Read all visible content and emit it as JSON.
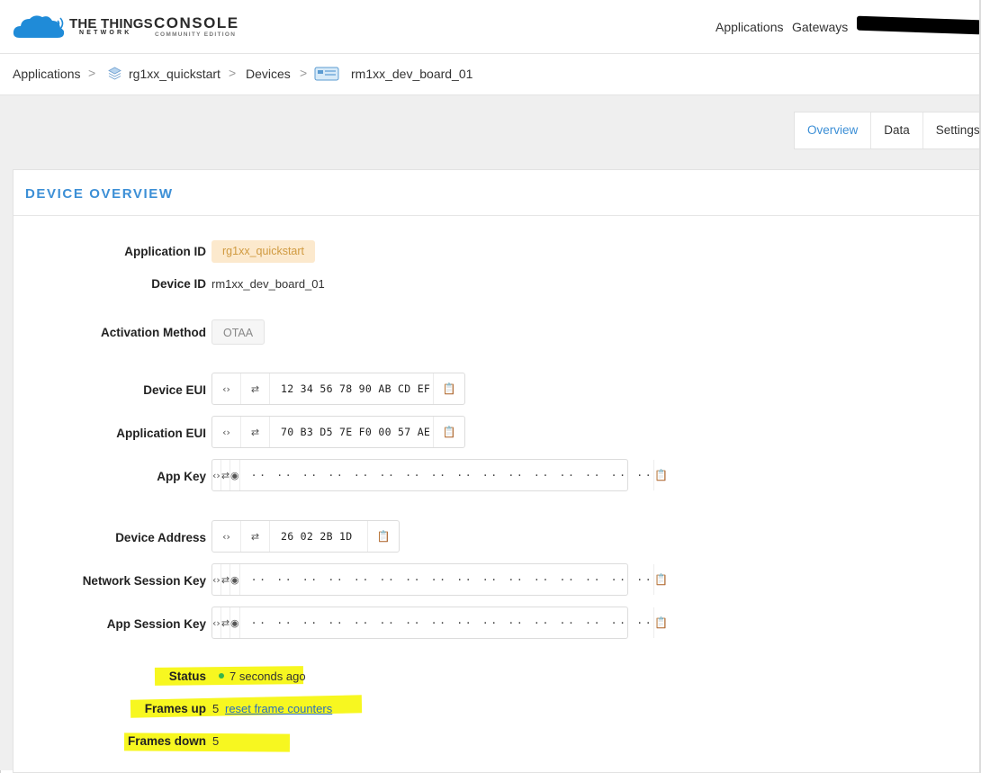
{
  "header": {
    "brand_line1": "THE THINGS",
    "brand_line2": "NETWORK",
    "console_line1": "CONSOLE",
    "console_line2": "COMMUNITY EDITION",
    "nav": [
      "Applications",
      "Gateways"
    ]
  },
  "breadcrumb": {
    "items": [
      "Applications",
      "rg1xx_quickstart",
      "Devices",
      "rm1xx_dev_board_01"
    ],
    "separator": ">"
  },
  "tabs": [
    "Overview",
    "Data",
    "Settings"
  ],
  "active_tab": "Overview",
  "card": {
    "title": "DEVICE OVERVIEW"
  },
  "fields": {
    "application_id": {
      "label": "Application ID",
      "value": "rg1xx_quickstart"
    },
    "device_id": {
      "label": "Device ID",
      "value": "rm1xx_dev_board_01"
    },
    "activation_method": {
      "label": "Activation Method",
      "value": "OTAA"
    },
    "device_eui": {
      "label": "Device EUI",
      "value": "12 34 56 78 90 AB CD EF"
    },
    "application_eui": {
      "label": "Application EUI",
      "value": "70 B3 D5 7E F0 00 57 AE"
    },
    "app_key": {
      "label": "App Key",
      "value": "·· ·· ·· ·· ·· ·· ·· ·· ·· ·· ·· ·· ·· ·· ·· ··"
    },
    "device_address": {
      "label": "Device Address",
      "value": "26 02 2B 1D"
    },
    "network_session_key": {
      "label": "Network Session Key",
      "value": "·· ·· ·· ·· ·· ·· ·· ·· ·· ·· ·· ·· ·· ·· ·· ··"
    },
    "app_session_key": {
      "label": "App Session Key",
      "value": "·· ·· ·· ·· ·· ·· ·· ·· ·· ·· ·· ·· ·· ·· ·· ··"
    }
  },
  "status": {
    "status_label": "Status",
    "status_value": "7 seconds ago",
    "frames_up_label": "Frames up",
    "frames_up_value": "5",
    "reset_link": "reset frame counters",
    "frames_down_label": "Frames down",
    "frames_down_value": "5"
  },
  "icons": {
    "code": "‹›",
    "swap": "⇄",
    "eye": "◉",
    "copy": "📋"
  },
  "colors": {
    "accent": "#3c8fd6",
    "highlight": "#f7f720",
    "online": "#39b54a",
    "app_tag_bg": "#fce9cd",
    "app_tag_text": "#d09a40"
  }
}
